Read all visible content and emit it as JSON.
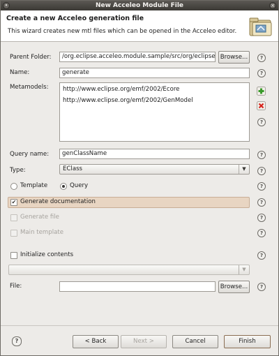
{
  "window": {
    "title": "New Acceleo Module File"
  },
  "header": {
    "title": "Create a new Acceleo generation file",
    "description": "This wizard creates new mtl files which can be opened in the Acceleo editor."
  },
  "form": {
    "parent_folder": {
      "label": "Parent Folder:",
      "value": "/org.eclipse.acceleo.module.sample/src/org/eclipse/",
      "browse_label": "Browse..."
    },
    "name": {
      "label": "Name:",
      "value": "generate"
    },
    "metamodels": {
      "label": "Metamodels:",
      "items": [
        "http://www.eclipse.org/emf/2002/Ecore",
        "http://www.eclipse.org/emf/2002/GenModel"
      ]
    },
    "query_name": {
      "label": "Query name:",
      "value": "genClassName"
    },
    "type": {
      "label": "Type:",
      "value": "EClass"
    },
    "kind": {
      "template_label": "Template",
      "query_label": "Query",
      "selected": "Query"
    },
    "generate_documentation": {
      "label": "Generate documentation",
      "checked": true
    },
    "generate_file": {
      "label": "Generate file",
      "checked": false,
      "enabled": false
    },
    "main_template": {
      "label": "Main template",
      "checked": false,
      "enabled": false
    },
    "initialize_contents": {
      "label": "Initialize contents",
      "checked": false
    },
    "init_combo": {
      "value": ""
    },
    "file": {
      "label": "File:",
      "value": "",
      "browse_label": "Browse..."
    }
  },
  "footer": {
    "back_label": "< Back",
    "next_label": "Next >",
    "cancel_label": "Cancel",
    "finish_label": "Finish"
  },
  "icons": {
    "help": "question-mark-icon",
    "add": "plus-icon",
    "remove": "red-x-icon",
    "wizard": "folder-icon"
  },
  "colors": {
    "title_bar": "#46433f",
    "highlight_row": "#e8d5c2",
    "add_green": "#3a9a2a",
    "remove_red": "#d6231c"
  }
}
